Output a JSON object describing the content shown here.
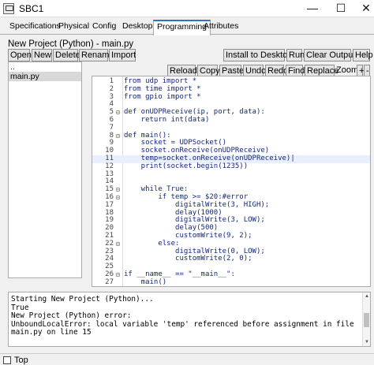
{
  "window": {
    "title": "SBC1",
    "min": "—",
    "max": "☐",
    "close": "✕"
  },
  "tabs": [
    "Specifications",
    "Physical",
    "Config",
    "Desktop",
    "Programming",
    "Attributes"
  ],
  "active_tab": "Programming",
  "project_title": "New Project (Python) - main.py",
  "toolbar": {
    "open": "Open",
    "new": "New",
    "delete": "Delete",
    "rename": "Rename",
    "import": "Import",
    "install": "Install to Desktop",
    "run": "Run",
    "clear": "Clear Outputs",
    "help": "Help"
  },
  "editor_toolbar": {
    "reload": "Reload",
    "copy": "Copy",
    "paste": "Paste",
    "undo": "Undo",
    "redo": "Redo",
    "find": "Find",
    "replace": "Replace",
    "zoom_label": "Zoom:",
    "zoom_in": "+",
    "zoom_out": "-"
  },
  "files": [
    "..",
    "main.py"
  ],
  "selected_file": "main.py",
  "code_lines": [
    {
      "n": "1",
      "text": "from udp import *"
    },
    {
      "n": "2",
      "text": "from time import *"
    },
    {
      "n": "3",
      "text": "from gpio import *"
    },
    {
      "n": "4",
      "text": ""
    },
    {
      "n": "5",
      "text": "def onUDPReceive(ip, port, data):",
      "fold": "⊟"
    },
    {
      "n": "6",
      "text": "    return int(data)"
    },
    {
      "n": "7",
      "text": ""
    },
    {
      "n": "8",
      "text": "def main():",
      "fold": "⊟"
    },
    {
      "n": "9",
      "text": "    socket = UDPSocket()"
    },
    {
      "n": "10",
      "text": "    socket.onReceive(onUDPReceive)"
    },
    {
      "n": "11",
      "text": "    temp=socket.onReceive(onUDPReceive)|",
      "current": true
    },
    {
      "n": "12",
      "text": "    print(socket.begin(1235))"
    },
    {
      "n": "13",
      "text": ""
    },
    {
      "n": "14",
      "text": ""
    },
    {
      "n": "15",
      "text": "    while True:",
      "fold": "⊟"
    },
    {
      "n": "16",
      "text": "        if temp >= $20:#error",
      "fold": "⊟"
    },
    {
      "n": "17",
      "text": "            digitalWrite(3, HIGH);"
    },
    {
      "n": "18",
      "text": "            delay(1000)"
    },
    {
      "n": "19",
      "text": "            digitalWrite(3, LOW);"
    },
    {
      "n": "20",
      "text": "            delay(500)"
    },
    {
      "n": "21",
      "text": "            customWrite(9, 2);"
    },
    {
      "n": "22",
      "text": "        else:",
      "fold": "⊟"
    },
    {
      "n": "23",
      "text": "            digitalWrite(0, LOW);"
    },
    {
      "n": "24",
      "text": "            customWrite(2, 0);"
    },
    {
      "n": "25",
      "text": ""
    },
    {
      "n": "26",
      "text": "if __name__ == \"__main__\":",
      "fold": "⊟"
    },
    {
      "n": "27",
      "text": "    main()"
    }
  ],
  "console_lines": [
    "Starting New Project (Python)...",
    "True",
    "New Project (Python) error:",
    "UnboundLocalError: local variable 'temp' referenced before assignment in file",
    "main.py on line 15"
  ],
  "bottom": {
    "top_label": "Top"
  },
  "colors": {
    "code": "#12287a",
    "active_tab_accent": "#2a73c9",
    "current_line": "#e8f0ff"
  }
}
